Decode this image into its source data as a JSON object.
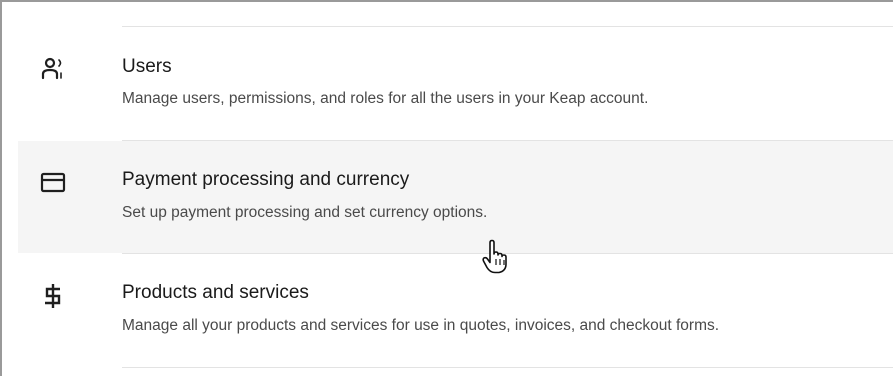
{
  "settings_list": {
    "items": [
      {
        "key": "users",
        "icon": "users-icon",
        "title": "Users",
        "description": "Manage users, permissions, and roles for all the users in your Keap account."
      },
      {
        "key": "payment",
        "icon": "credit-card-icon",
        "title": "Payment processing and currency",
        "description": "Set up payment processing and set currency options."
      },
      {
        "key": "products",
        "icon": "dollar-sign-icon",
        "title": "Products and services",
        "description": "Manage all your products and services for use in quotes, invoices, and checkout forms."
      }
    ],
    "hovered_item": "payment"
  },
  "cursor": {
    "icon": "hand-pointer-cursor-icon"
  },
  "colors": {
    "hover_background": "#f5f5f5",
    "divider": "#e3e3e3",
    "title_text": "#1a1a1a",
    "description_text": "#4a4a4a",
    "frame_border": "#9a9a9a"
  }
}
